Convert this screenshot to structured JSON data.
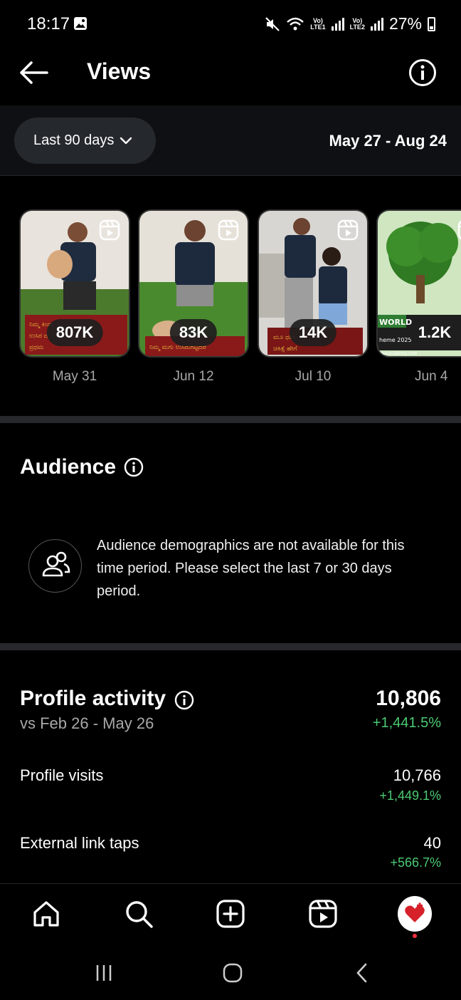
{
  "status_bar": {
    "time": "18:17",
    "battery": "27%",
    "net1": "Vo)\nLTE1",
    "net2": "Vo)\nLTE2"
  },
  "header": {
    "title": "Views"
  },
  "filter": {
    "range_label": "Last 90 days",
    "date_range": "May 27 - Aug 24"
  },
  "reels": [
    {
      "views": "807K",
      "date": "May 31"
    },
    {
      "views": "83K",
      "date": "Jun 12"
    },
    {
      "views": "14K",
      "date": "Jul 10"
    },
    {
      "views": "1.2K",
      "date": "Jun 4"
    }
  ],
  "audience": {
    "title": "Audience",
    "message": "Audience demographics are not available for this time period. Please select the last 7 or 30 days period."
  },
  "profile_activity": {
    "title": "Profile activity",
    "total": "10,806",
    "compare": "vs Feb 26 - May 26",
    "total_change": "+1,441.5%",
    "metrics": [
      {
        "label": "Profile visits",
        "value": "10,766",
        "change": "+1,449.1%"
      },
      {
        "label": "External link taps",
        "value": "40",
        "change": "+566.7%"
      }
    ]
  },
  "colors": {
    "positive": "#4cca73",
    "pill_bg": "#25292e",
    "filter_bg": "#0e1013"
  },
  "icons": [
    "back-arrow-icon",
    "info-icon",
    "chevron-down-icon",
    "reel-icon",
    "people-icon",
    "home-icon",
    "search-icon",
    "create-icon",
    "reels-icon",
    "profile-avatar"
  ]
}
